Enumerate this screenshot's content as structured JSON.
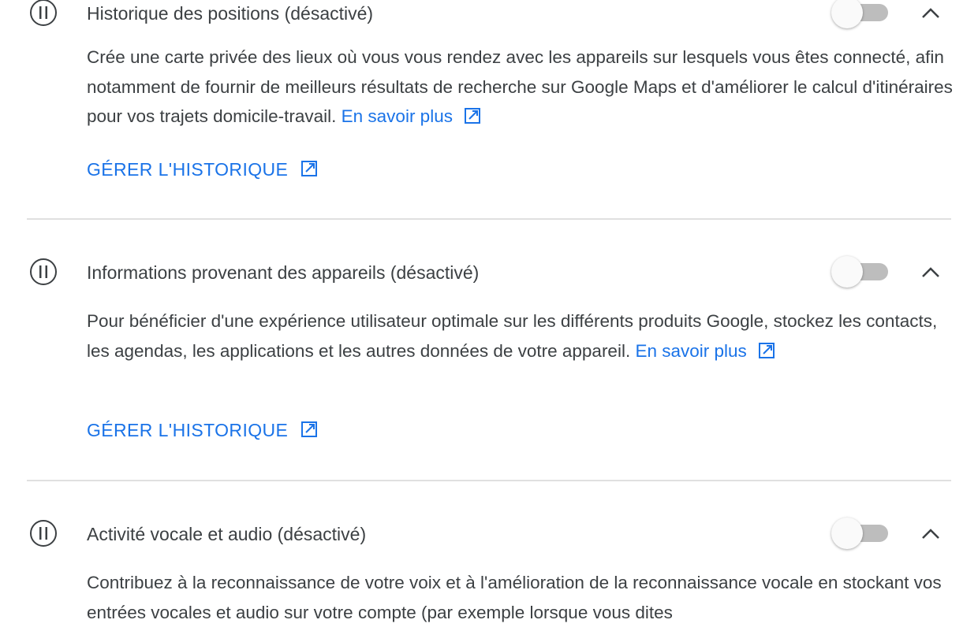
{
  "sections": [
    {
      "title": "Historique des positions (désactivé)",
      "description": "Crée une carte privée des lieux où vous vous rendez avec les appareils sur lesquels vous êtes connecté, afin notamment de fournir de meilleurs résultats de recherche sur Google Maps et d'améliorer le calcul d'itinéraires pour vos trajets domicile-travail.",
      "learn_more": "En savoir plus",
      "manage_label": "GÉRER L'HISTORIQUE",
      "toggle_on": false
    },
    {
      "title": "Informations provenant des appareils (désactivé)",
      "description": "Pour bénéficier d'une expérience utilisateur optimale sur les différents produits Google, stockez les contacts, les agendas, les applications et les autres données de votre appareil.",
      "learn_more": "En savoir plus",
      "manage_label": "GÉRER L'HISTORIQUE",
      "toggle_on": false
    },
    {
      "title": "Activité vocale et audio (désactivé)",
      "description": "Contribuez à la reconnaissance de votre voix et à l'amélioration de la reconnaissance vocale en stockant vos entrées vocales et audio sur votre compte (par exemple lorsque vous dites",
      "toggle_on": false
    }
  ],
  "icons": {
    "status": "pause-circle-icon",
    "expand": "chevron-up-icon",
    "external": "open-in-new-icon"
  },
  "colors": {
    "link": "#1a73e8",
    "text": "#3c4043",
    "toggle_track_off": "#bdbdbd",
    "divider": "#e0e0e0"
  }
}
